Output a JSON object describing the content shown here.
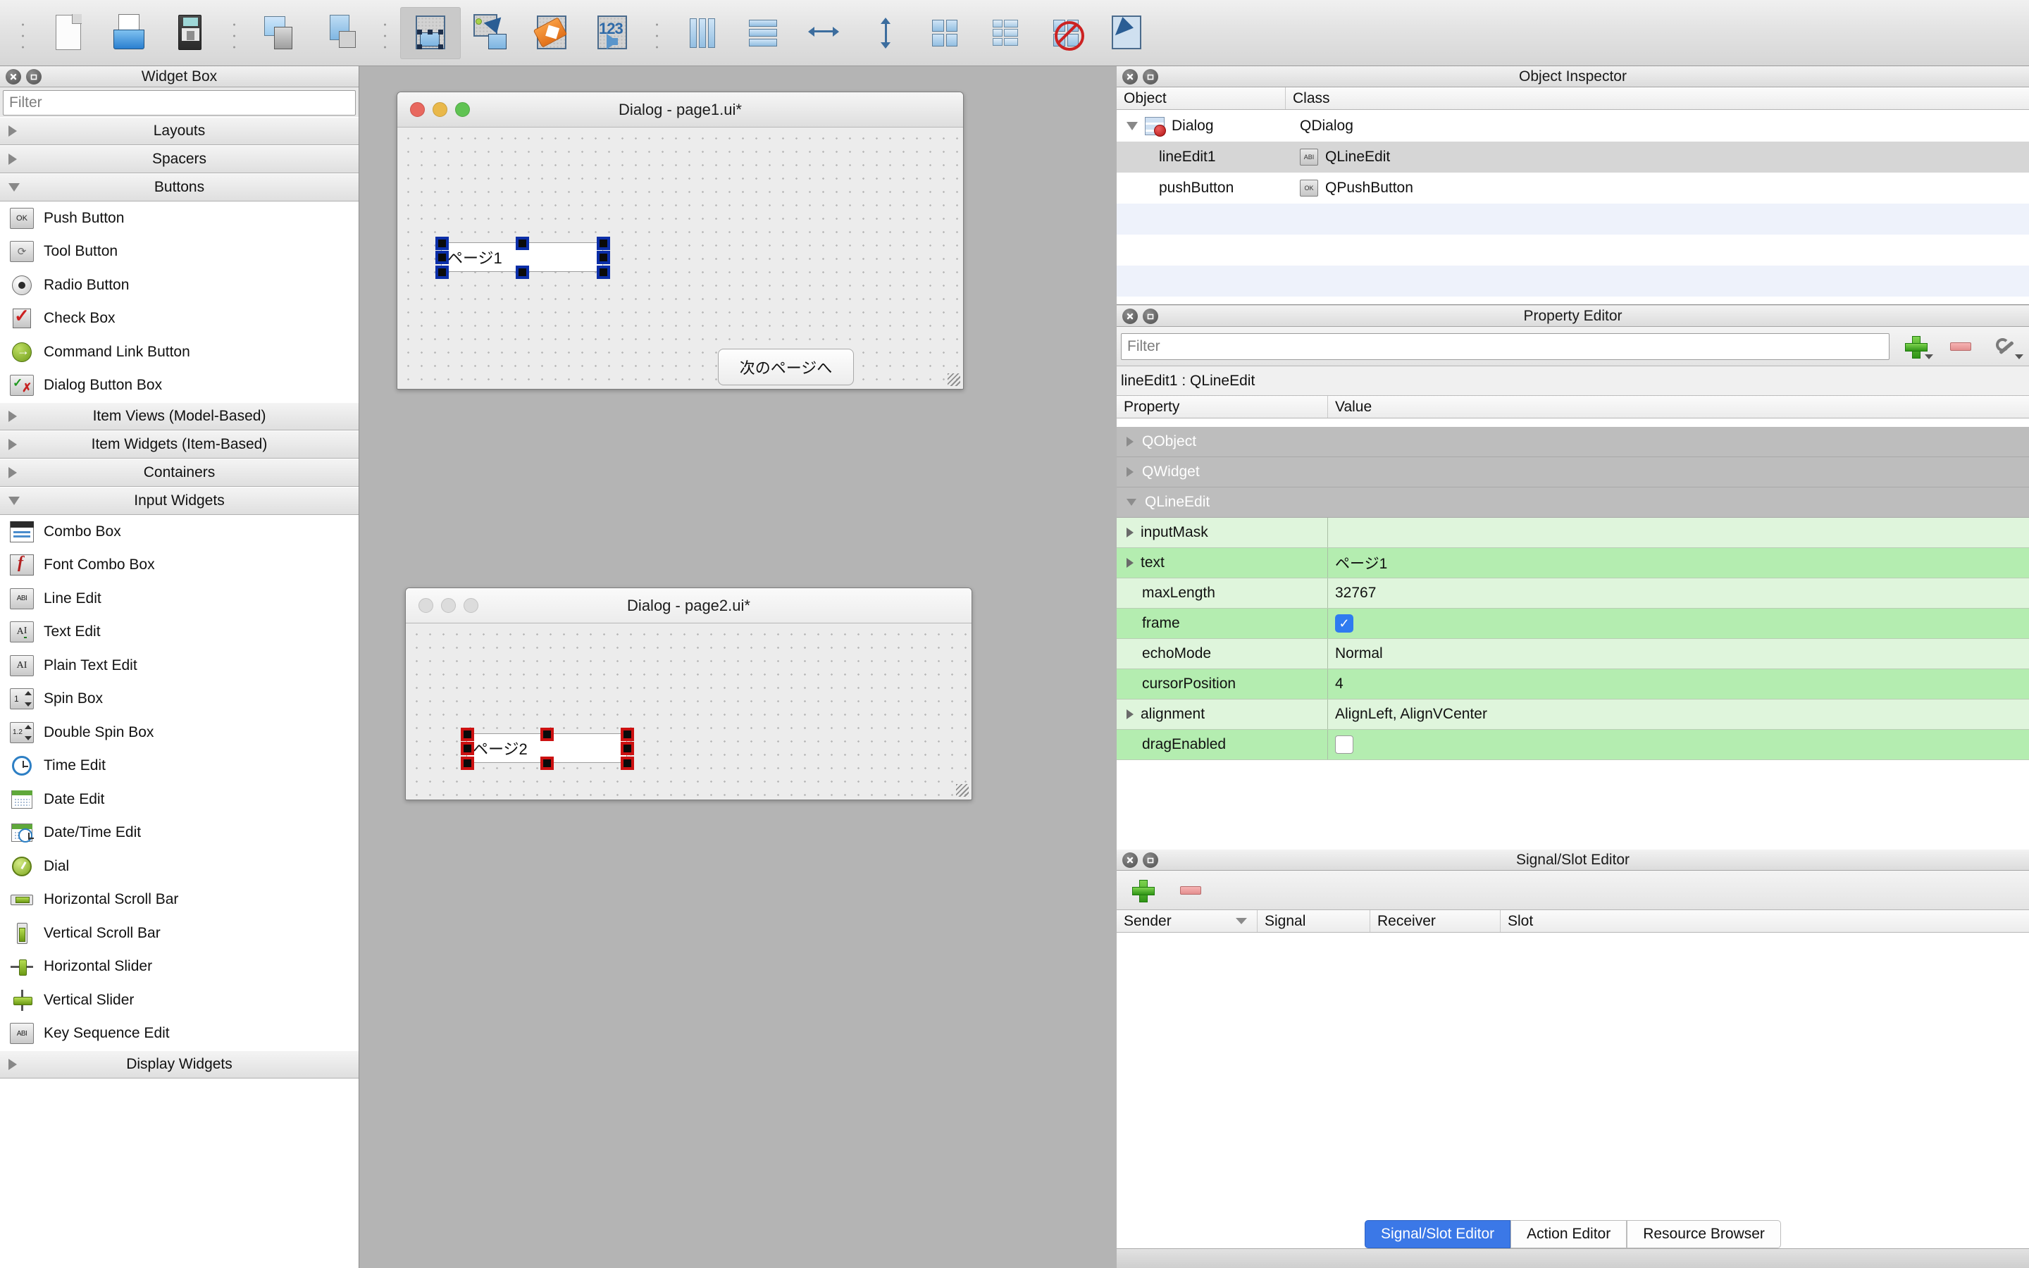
{
  "toolbar": {
    "items": [
      {
        "name": "new-form-button",
        "icon": "new-file-icon",
        "active": false
      },
      {
        "name": "open-form-button",
        "icon": "open-folder-icon",
        "active": false
      },
      {
        "name": "save-form-button",
        "icon": "floppy-save-icon",
        "active": false
      },
      {
        "name": "cascade-windows-button",
        "icon": "cascade-windows-icon",
        "active": false
      },
      {
        "name": "tile-windows-button",
        "icon": "tile-windows-icon",
        "active": false
      },
      {
        "name": "edit-widgets-button",
        "icon": "edit-widgets-icon",
        "active": true
      },
      {
        "name": "edit-signals-slots-button",
        "icon": "signals-slots-icon",
        "active": false
      },
      {
        "name": "edit-buddies-button",
        "icon": "buddy-tag-icon",
        "active": false
      },
      {
        "name": "edit-tab-order-button",
        "icon": "tab-order-icon",
        "active": false
      },
      {
        "name": "layout-horizontally-button",
        "icon": "layout-horizontal-icon",
        "active": false
      },
      {
        "name": "layout-vertically-button",
        "icon": "layout-vertical-icon",
        "active": false
      },
      {
        "name": "layout-splitter-horizontal-button",
        "icon": "splitter-horizontal-icon",
        "active": false
      },
      {
        "name": "layout-splitter-vertical-button",
        "icon": "splitter-vertical-icon",
        "active": false
      },
      {
        "name": "layout-grid-button",
        "icon": "layout-grid-icon",
        "active": false
      },
      {
        "name": "layout-form-button",
        "icon": "layout-form-icon",
        "active": false
      },
      {
        "name": "break-layout-button",
        "icon": "break-layout-icon",
        "active": false
      },
      {
        "name": "adjust-size-button",
        "icon": "adjust-size-icon",
        "active": false
      }
    ]
  },
  "widget_box": {
    "title": "Widget Box",
    "filter_placeholder": "Filter",
    "groups": [
      {
        "label": "Layouts",
        "expanded": false,
        "items": []
      },
      {
        "label": "Spacers",
        "expanded": false,
        "items": []
      },
      {
        "label": "Buttons",
        "expanded": true,
        "items": [
          {
            "label": "Push Button",
            "icon": "push-button-icon"
          },
          {
            "label": "Tool Button",
            "icon": "tool-button-icon"
          },
          {
            "label": "Radio Button",
            "icon": "radio-button-icon"
          },
          {
            "label": "Check Box",
            "icon": "check-box-icon"
          },
          {
            "label": "Command Link Button",
            "icon": "command-link-button-icon"
          },
          {
            "label": "Dialog Button Box",
            "icon": "dialog-button-box-icon"
          }
        ]
      },
      {
        "label": "Item Views (Model-Based)",
        "expanded": false,
        "items": []
      },
      {
        "label": "Item Widgets (Item-Based)",
        "expanded": false,
        "items": []
      },
      {
        "label": "Containers",
        "expanded": false,
        "items": []
      },
      {
        "label": "Input Widgets",
        "expanded": true,
        "items": [
          {
            "label": "Combo Box",
            "icon": "combo-box-icon"
          },
          {
            "label": "Font Combo Box",
            "icon": "font-combo-box-icon"
          },
          {
            "label": "Line Edit",
            "icon": "line-edit-icon"
          },
          {
            "label": "Text Edit",
            "icon": "text-edit-icon"
          },
          {
            "label": "Plain Text Edit",
            "icon": "plain-text-edit-icon"
          },
          {
            "label": "Spin Box",
            "icon": "spin-box-icon"
          },
          {
            "label": "Double Spin Box",
            "icon": "double-spin-box-icon"
          },
          {
            "label": "Time Edit",
            "icon": "time-edit-icon"
          },
          {
            "label": "Date Edit",
            "icon": "date-edit-icon"
          },
          {
            "label": "Date/Time Edit",
            "icon": "date-time-edit-icon"
          },
          {
            "label": "Dial",
            "icon": "dial-icon"
          },
          {
            "label": "Horizontal Scroll Bar",
            "icon": "horizontal-scroll-bar-icon"
          },
          {
            "label": "Vertical Scroll Bar",
            "icon": "vertical-scroll-bar-icon"
          },
          {
            "label": "Horizontal Slider",
            "icon": "horizontal-slider-icon"
          },
          {
            "label": "Vertical Slider",
            "icon": "vertical-slider-icon"
          },
          {
            "label": "Key Sequence Edit",
            "icon": "key-sequence-edit-icon"
          }
        ]
      },
      {
        "label": "Display Widgets",
        "expanded": false,
        "items": []
      }
    ]
  },
  "forms": [
    {
      "title": "Dialog - page1.ui*",
      "active": true,
      "traffic_lights": [
        "#e8685f",
        "#e9b84a",
        "#60c353"
      ],
      "widgets": [
        {
          "name": "lineEdit1",
          "type": "line-edit",
          "text": "ページ1",
          "selected": true,
          "selection_color": "#0b2ea8"
        },
        {
          "name": "pushButton",
          "type": "push-button",
          "text": "次のページへ",
          "selected": false
        }
      ]
    },
    {
      "title": "Dialog - page2.ui*",
      "active": false,
      "traffic_lights": [
        "#d6d6d6",
        "#d6d6d6",
        "#d6d6d6"
      ],
      "widgets": [
        {
          "name": "lineEdit1",
          "type": "line-edit",
          "text": "ページ2",
          "selected": true,
          "selection_color": "#cc1111"
        }
      ]
    }
  ],
  "object_inspector": {
    "title": "Object Inspector",
    "columns": [
      "Object",
      "Class"
    ],
    "rows": [
      {
        "object": "Dialog",
        "class": "QDialog",
        "depth": 0,
        "expanded": true,
        "selected": false,
        "icon": "qdialog-icon"
      },
      {
        "object": "lineEdit1",
        "class": "QLineEdit",
        "depth": 1,
        "expanded": false,
        "selected": true,
        "icon": "qlineedit-icon"
      },
      {
        "object": "pushButton",
        "class": "QPushButton",
        "depth": 1,
        "expanded": false,
        "selected": false,
        "icon": "qpushbutton-icon"
      }
    ]
  },
  "property_editor": {
    "title": "Property Editor",
    "filter_placeholder": "Filter",
    "object_line": "lineEdit1 : QLineEdit",
    "columns": [
      "Property",
      "Value"
    ],
    "toolbar": [
      {
        "name": "add-dynamic-property-button",
        "icon": "plus-green-icon"
      },
      {
        "name": "remove-dynamic-property-button",
        "icon": "minus-red-icon"
      },
      {
        "name": "configure-property-editor-button",
        "icon": "wrench-icon"
      }
    ],
    "rows": [
      {
        "kind": "group",
        "property": "QObject",
        "expanded": false,
        "value": ""
      },
      {
        "kind": "group",
        "property": "QWidget",
        "expanded": false,
        "value": ""
      },
      {
        "kind": "group",
        "property": "QLineEdit",
        "expanded": true,
        "value": ""
      },
      {
        "kind": "prop",
        "property": "inputMask",
        "value": "",
        "expandable": true,
        "shade": "lite"
      },
      {
        "kind": "prop",
        "property": "text",
        "value": "ページ1",
        "expandable": true,
        "shade": "dark"
      },
      {
        "kind": "prop",
        "property": "maxLength",
        "value": "32767",
        "expandable": false,
        "shade": "lite"
      },
      {
        "kind": "prop",
        "property": "frame",
        "value": "",
        "checkbox": "on",
        "expandable": false,
        "shade": "dark"
      },
      {
        "kind": "prop",
        "property": "echoMode",
        "value": "Normal",
        "expandable": false,
        "shade": "lite"
      },
      {
        "kind": "prop",
        "property": "cursorPosition",
        "value": "4",
        "expandable": false,
        "shade": "dark"
      },
      {
        "kind": "prop",
        "property": "alignment",
        "value": "AlignLeft, AlignVCenter",
        "expandable": true,
        "shade": "lite"
      },
      {
        "kind": "prop",
        "property": "dragEnabled",
        "value": "",
        "checkbox": "off",
        "expandable": false,
        "shade": "dark"
      }
    ]
  },
  "signal_slot_editor": {
    "title": "Signal/Slot Editor",
    "toolbar": [
      {
        "name": "add-connection-button",
        "icon": "plus-green-icon"
      },
      {
        "name": "remove-connection-button",
        "icon": "minus-red-icon"
      }
    ],
    "columns": [
      "Sender",
      "Signal",
      "Receiver",
      "Slot"
    ],
    "sorted_column": "Sender",
    "rows": []
  },
  "bottom_tabs": [
    {
      "label": "Signal/Slot Editor",
      "active": true
    },
    {
      "label": "Action Editor",
      "active": false
    },
    {
      "label": "Resource Browser",
      "active": false
    }
  ]
}
